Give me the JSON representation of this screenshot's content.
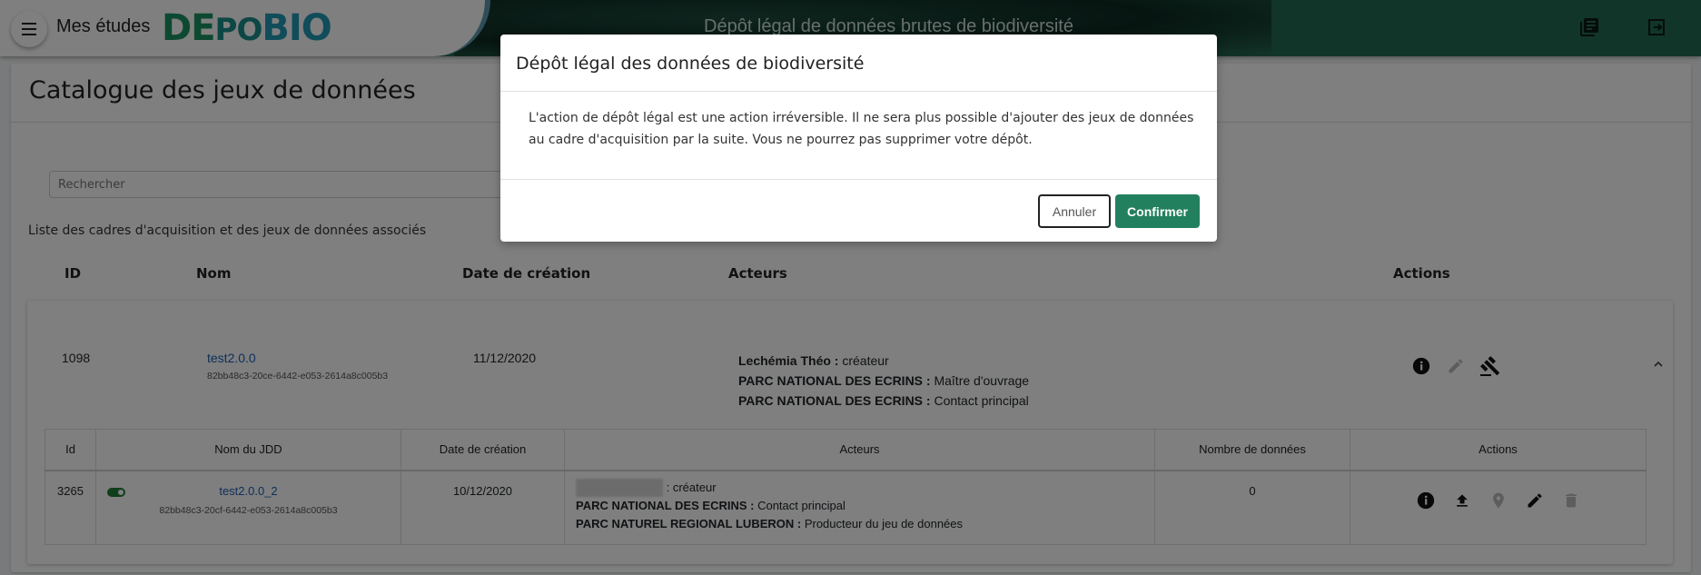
{
  "header": {
    "app_name": "Mes études",
    "logo": {
      "part1": "DE",
      "part2": "PO",
      "part3": "BIO"
    },
    "subtitle": "Dépôt légal de données brutes de biodiversité",
    "icons": [
      "menu-icon",
      "library-books-icon",
      "logout-icon"
    ]
  },
  "page": {
    "title": "Catalogue des jeux de données",
    "search_placeholder": "Rechercher",
    "list_label": "Liste des cadres d'acquisition et des jeux de données associés",
    "columns": [
      "ID",
      "Nom",
      "Date de création",
      "Acteurs",
      "Actions"
    ]
  },
  "acquisition_framework": {
    "id": "1098",
    "name": "test2.0.0",
    "uuid": "82bb48c3-20ce-6442-e053-2614a8c005b3",
    "date": "11/12/2020",
    "actors": [
      {
        "name": "Lechémia Théo :",
        "role": " créateur"
      },
      {
        "name": "PARC NATIONAL DES ECRINS :",
        "role": " Maître d'ouvrage"
      },
      {
        "name": "PARC NATIONAL DES ECRINS :",
        "role": " Contact principal"
      }
    ],
    "actions": [
      "info-icon",
      "edit-icon",
      "legal-deposit-gavel-icon"
    ],
    "expanded": true
  },
  "datasets_table": {
    "columns": [
      "Id",
      "Nom du JDD",
      "Date de création",
      "Acteurs",
      "Nombre de données",
      "Actions"
    ],
    "rows": [
      {
        "id": "3265",
        "active": true,
        "name": "test2.0.0_2",
        "uuid": "82bb48c3-20cf-6442-e053-2614a8c005b3",
        "date": "10/12/2020",
        "actors": [
          {
            "name": "",
            "role": " : créateur",
            "redacted": true
          },
          {
            "name": "PARC NATIONAL DES ECRINS :",
            "role": " Contact principal"
          },
          {
            "name": "PARC NATUREL REGIONAL LUBERON :",
            "role": " Producteur du jeu de données"
          }
        ],
        "count": "0",
        "actions": [
          "info-icon",
          "upload-icon",
          "map-marker-icon",
          "edit-icon",
          "delete-icon"
        ]
      }
    ]
  },
  "modal": {
    "title": "Dépôt légal des données de biodiversité",
    "body": "L'action de dépôt légal est une action irréversible. Il ne sera plus possible d'ajouter des jeux de données au cadre d'acquisition par la suite. Vous ne pourrez pas supprimer votre dépôt.",
    "cancel_label": "Annuler",
    "confirm_label": "Confirmer"
  },
  "colors": {
    "header_bg": "#256b53",
    "confirm_bg": "#23805f",
    "link": "#1a5fb4",
    "toggle_on": "#1e7e34"
  }
}
